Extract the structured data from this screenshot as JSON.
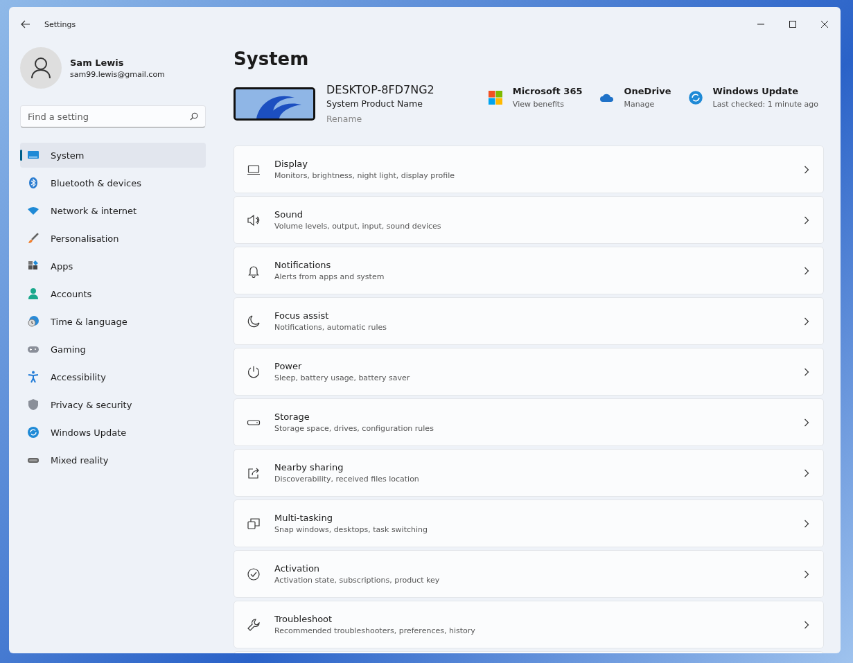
{
  "window": {
    "title": "Settings"
  },
  "user": {
    "name": "Sam Lewis",
    "email": "sam99.lewis@gmail.com"
  },
  "search": {
    "placeholder": "Find a setting"
  },
  "sidebar": {
    "items": [
      {
        "label": "System",
        "kind": "system",
        "selected": true
      },
      {
        "label": "Bluetooth & devices",
        "kind": "bluetooth",
        "selected": false
      },
      {
        "label": "Network & internet",
        "kind": "network",
        "selected": false
      },
      {
        "label": "Personalisation",
        "kind": "brush",
        "selected": false
      },
      {
        "label": "Apps",
        "kind": "apps",
        "selected": false
      },
      {
        "label": "Accounts",
        "kind": "accounts",
        "selected": false
      },
      {
        "label": "Time & language",
        "kind": "time",
        "selected": false
      },
      {
        "label": "Gaming",
        "kind": "gaming",
        "selected": false
      },
      {
        "label": "Accessibility",
        "kind": "accessibility",
        "selected": false
      },
      {
        "label": "Privacy & security",
        "kind": "shield",
        "selected": false
      },
      {
        "label": "Windows Update",
        "kind": "update",
        "selected": false
      },
      {
        "label": "Mixed reality",
        "kind": "headset",
        "selected": false
      }
    ]
  },
  "page": {
    "title": "System"
  },
  "device": {
    "name": "DESKTOP-8FD7NG2",
    "model": "System Product Name",
    "rename": "Rename"
  },
  "quick_links": [
    {
      "kind": "microsoft",
      "title": "Microsoft 365",
      "subtitle": "View benefits"
    },
    {
      "kind": "cloud",
      "title": "OneDrive",
      "subtitle": "Manage"
    },
    {
      "kind": "update",
      "title": "Windows Update",
      "subtitle": "Last checked: 1 minute ago"
    }
  ],
  "settings": [
    {
      "kind": "display",
      "title": "Display",
      "subtitle": "Monitors, brightness, night light, display profile"
    },
    {
      "kind": "sound",
      "title": "Sound",
      "subtitle": "Volume levels, output, input, sound devices"
    },
    {
      "kind": "bell",
      "title": "Notifications",
      "subtitle": "Alerts from apps and system"
    },
    {
      "kind": "moon",
      "title": "Focus assist",
      "subtitle": "Notifications, automatic rules"
    },
    {
      "kind": "power",
      "title": "Power",
      "subtitle": "Sleep, battery usage, battery saver"
    },
    {
      "kind": "storage",
      "title": "Storage",
      "subtitle": "Storage space, drives, configuration rules"
    },
    {
      "kind": "share",
      "title": "Nearby sharing",
      "subtitle": "Discoverability, received files location"
    },
    {
      "kind": "multitask",
      "title": "Multi-tasking",
      "subtitle": "Snap windows, desktops, task switching"
    },
    {
      "kind": "check",
      "title": "Activation",
      "subtitle": "Activation state, subscriptions, product key"
    },
    {
      "kind": "wrench",
      "title": "Troubleshoot",
      "subtitle": "Recommended troubleshooters, preferences, history"
    },
    {
      "kind": "blank"
    }
  ]
}
